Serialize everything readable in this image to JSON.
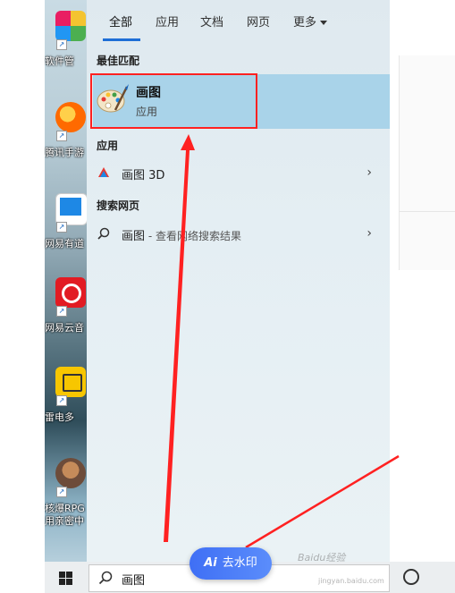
{
  "desktop": {
    "icons": [
      {
        "label": "软件管",
        "icon": "pinwheel-app-icon",
        "color": "#f4c430"
      },
      {
        "label": "腾讯手游",
        "icon": "game-assistant-icon",
        "color": "#ff6a00"
      },
      {
        "label": "网易有道",
        "icon": "youdao-icon",
        "color": "#1e88e5"
      },
      {
        "label": "网易云音",
        "icon": "netease-music-icon",
        "color": "#e21b23"
      },
      {
        "label": "雷电多",
        "icon": "ldplayer-icon",
        "color": "#f7c600"
      },
      {
        "label": "核爆RPG",
        "label2": "用亲密中",
        "icon": "rpg-game-icon",
        "color": "#6d4c3a"
      }
    ]
  },
  "search_panel": {
    "tabs": [
      {
        "label": "全部",
        "active": true
      },
      {
        "label": "应用"
      },
      {
        "label": "文档"
      },
      {
        "label": "网页"
      },
      {
        "label": "更多"
      }
    ],
    "best_match_title": "最佳匹配",
    "best_match": {
      "name": "画图",
      "type": "应用",
      "icon": "paint-palette-icon"
    },
    "apps_title": "应用",
    "apps": [
      {
        "name": "画图 3D",
        "icon": "paint3d-icon"
      }
    ],
    "web_title": "搜索网页",
    "web_results": [
      {
        "name": "画图",
        "suffix": " - 查看网络搜索结果",
        "icon": "search-icon"
      }
    ],
    "accent": "#1e6ed6",
    "highlight": "#a9d3e9"
  },
  "taskbar": {
    "search_value": "画图"
  },
  "overlay": {
    "ai_button": "去水印",
    "ai_prefix": "Ai",
    "watermark": "Baidu经验",
    "watermark_sub": "jingyan.baidu.com"
  },
  "annotation_color": "#ff2121"
}
